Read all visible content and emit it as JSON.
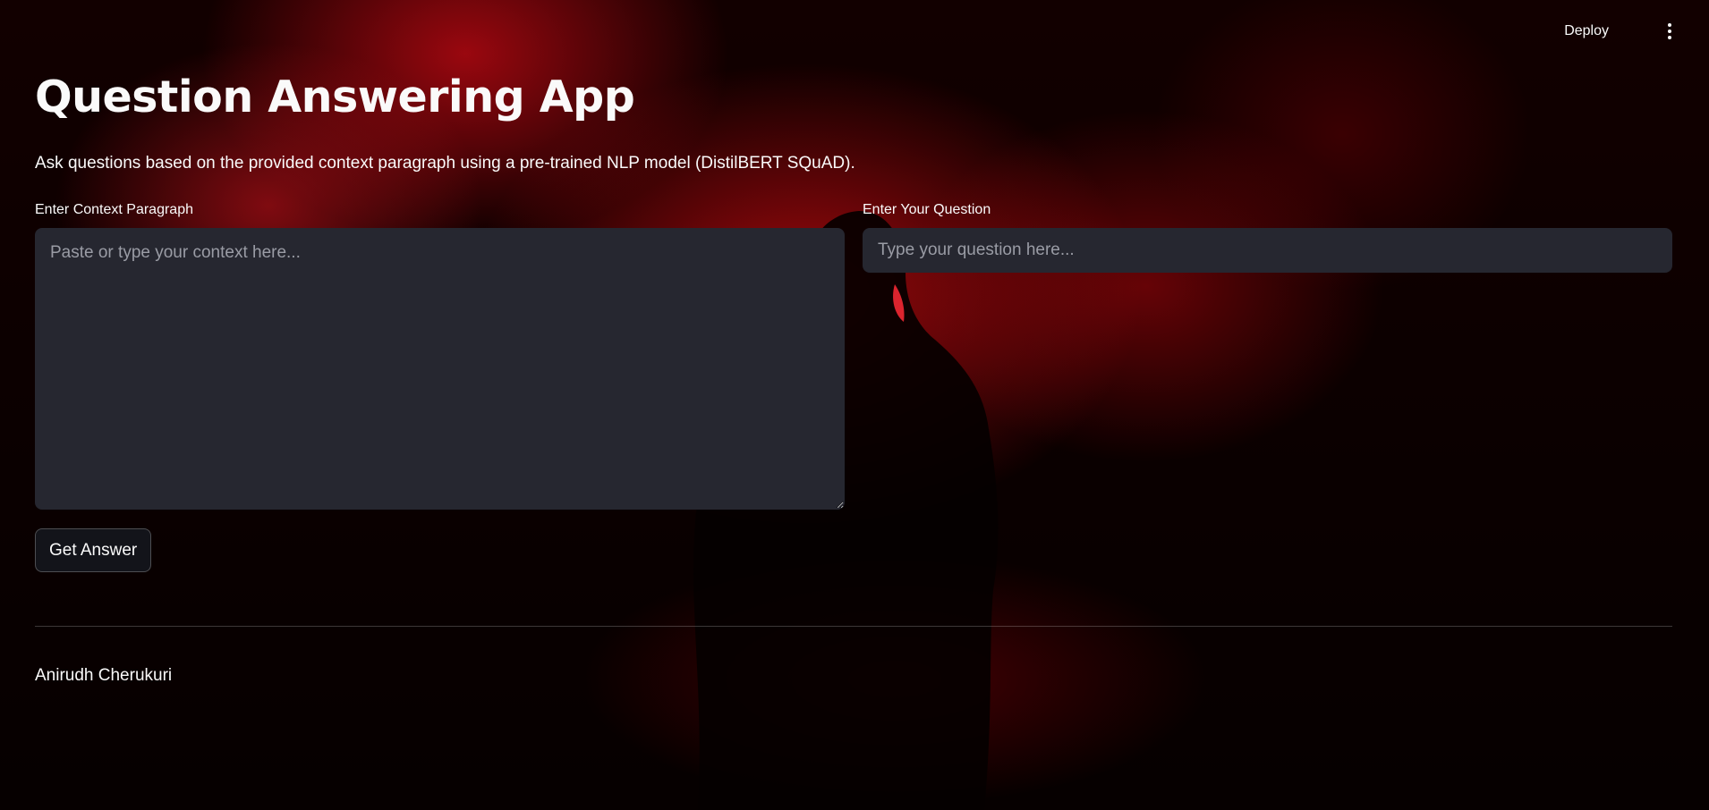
{
  "header": {
    "deploy_label": "Deploy",
    "menu_icon": "vertical-ellipsis-icon"
  },
  "main": {
    "title": "Question Answering App",
    "subtitle": "Ask questions based on the provided context paragraph using a pre-trained NLP model (DistilBERT SQuAD).",
    "context": {
      "label": "Enter Context Paragraph",
      "placeholder": "Paste or type your context here...",
      "value": ""
    },
    "question": {
      "label": "Enter Your Question",
      "placeholder": "Type your question here...",
      "value": ""
    },
    "submit_label": "Get Answer"
  },
  "footer": {
    "author": "Anirudh Cherukuri"
  },
  "colors": {
    "background": "#0a0000",
    "accent_red": "#c8101a",
    "input_bg": "#262730",
    "text": "#fafafa",
    "placeholder": "#9a9ca5"
  }
}
